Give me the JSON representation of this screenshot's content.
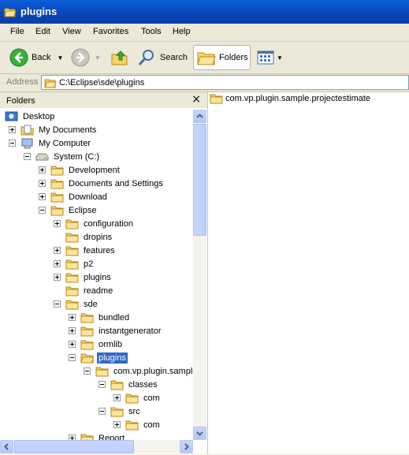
{
  "window": {
    "title": "plugins"
  },
  "menu": [
    "File",
    "Edit",
    "View",
    "Favorites",
    "Tools",
    "Help"
  ],
  "toolbar": {
    "back": "Back",
    "search": "Search",
    "folders": "Folders"
  },
  "address": {
    "label": "Address",
    "path": "C:\\Eclipse\\sde\\plugins"
  },
  "folders_pane": {
    "title": "Folders",
    "close": "×"
  },
  "tree": [
    {
      "label": "Desktop",
      "expander": "none",
      "icon": "desktop-icon"
    },
    {
      "label": "My Documents",
      "expander": "plus",
      "icon": "my-documents-icon"
    },
    {
      "label": "My Computer",
      "expander": "minus",
      "icon": "my-computer-icon"
    },
    {
      "label": "System (C:)",
      "expander": "minus",
      "icon": "drive-icon"
    },
    {
      "label": "Development",
      "expander": "plus",
      "icon": "folder-icon"
    },
    {
      "label": "Documents and Settings",
      "expander": "plus",
      "icon": "folder-icon"
    },
    {
      "label": "Download",
      "expander": "plus",
      "icon": "folder-icon"
    },
    {
      "label": "Eclipse",
      "expander": "minus",
      "icon": "folder-icon"
    },
    {
      "label": "configuration",
      "expander": "plus",
      "icon": "folder-icon"
    },
    {
      "label": "dropins",
      "expander": "none",
      "icon": "folder-icon"
    },
    {
      "label": "features",
      "expander": "plus",
      "icon": "folder-icon"
    },
    {
      "label": "p2",
      "expander": "plus",
      "icon": "folder-icon"
    },
    {
      "label": "plugins",
      "expander": "plus",
      "icon": "folder-icon"
    },
    {
      "label": "readme",
      "expander": "none",
      "icon": "folder-icon"
    },
    {
      "label": "sde",
      "expander": "minus",
      "icon": "folder-icon"
    },
    {
      "label": "bundled",
      "expander": "plus",
      "icon": "folder-icon"
    },
    {
      "label": "instantgenerator",
      "expander": "plus",
      "icon": "folder-icon"
    },
    {
      "label": "ormlib",
      "expander": "plus",
      "icon": "folder-icon"
    },
    {
      "label": "plugins",
      "expander": "minus",
      "icon": "open-folder-icon",
      "selected": true
    },
    {
      "label": "com.vp.plugin.sample",
      "expander": "minus",
      "icon": "folder-icon"
    },
    {
      "label": "classes",
      "expander": "minus",
      "icon": "folder-icon"
    },
    {
      "label": "com",
      "expander": "plus",
      "icon": "folder-icon"
    },
    {
      "label": "src",
      "expander": "minus",
      "icon": "folder-icon"
    },
    {
      "label": "com",
      "expander": "plus",
      "icon": "folder-icon"
    },
    {
      "label": "Report",
      "expander": "plus",
      "icon": "folder-icon"
    }
  ],
  "files": [
    {
      "name": "com.vp.plugin.sample.projectestimate",
      "icon": "folder-icon"
    }
  ],
  "colors": {
    "titlebar": "#0a52d0",
    "selection": "#316ac5",
    "folder": "#f6d36b"
  }
}
